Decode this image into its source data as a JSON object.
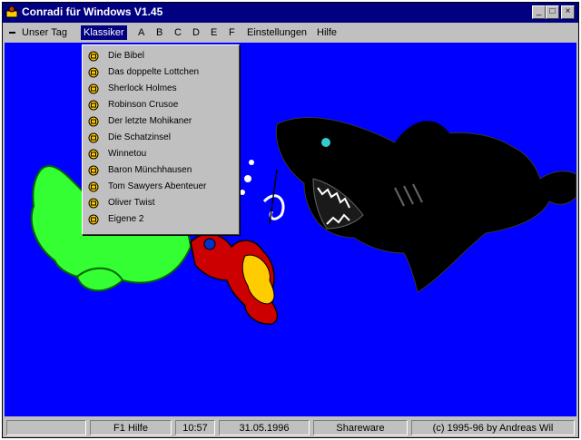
{
  "window": {
    "title": "Conradi für Windows V1.45",
    "controls": {
      "minimize": "_",
      "maximize": "□",
      "close": "×"
    }
  },
  "menu": {
    "items": [
      {
        "label": "Unser Tag"
      },
      {
        "label": "Klassiker"
      },
      {
        "label": "A"
      },
      {
        "label": "B"
      },
      {
        "label": "C"
      },
      {
        "label": "D"
      },
      {
        "label": "E"
      },
      {
        "label": "F"
      },
      {
        "label": "Einstellungen"
      },
      {
        "label": "Hilfe"
      }
    ]
  },
  "dropdown": {
    "items": [
      {
        "label": "Die Bibel"
      },
      {
        "label": "Das doppelte Lottchen"
      },
      {
        "label": "Sherlock Holmes"
      },
      {
        "label": "Robinson Crusoe"
      },
      {
        "label": "Der letzte Mohikaner"
      },
      {
        "label": "Die Schatzinsel"
      },
      {
        "label": "Winnetou"
      },
      {
        "label": "Baron Münchhausen"
      },
      {
        "label": "Tom Sawyers Abenteuer"
      },
      {
        "label": "Oliver Twist"
      },
      {
        "label": "Eigene 2"
      }
    ]
  },
  "status": {
    "help": "F1 Hilfe",
    "time": "10:57",
    "date": "31.05.1996",
    "license": "Shareware",
    "copyright": "(c) 1995-96 by Andreas Wil"
  },
  "colors": {
    "titlebar": "#000080",
    "scene_background": "#0000ff",
    "fish": "#33ff33",
    "shark": "#000000"
  }
}
